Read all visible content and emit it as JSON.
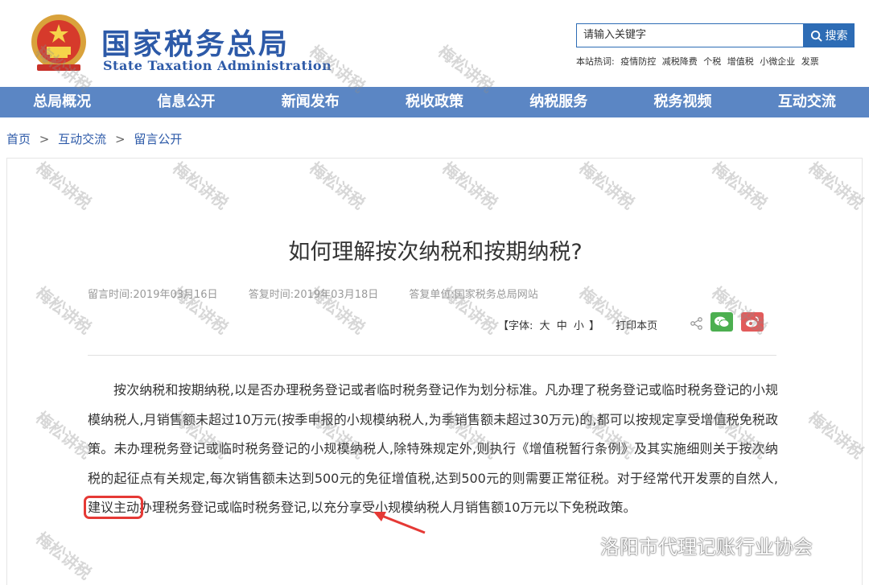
{
  "header": {
    "site_title": "国家税务总局",
    "site_subtitle": "State Taxation Administration",
    "search_placeholder": "请输入关键字",
    "search_button": "搜索",
    "hotwords_label": "本站热词:",
    "hotwords": [
      "疫情防控",
      "减税降费",
      "个税",
      "增值税",
      "小微企业",
      "发票"
    ]
  },
  "nav": {
    "items": [
      "总局概况",
      "信息公开",
      "新闻发布",
      "税收政策",
      "纳税服务",
      "税务视频",
      "互动交流"
    ]
  },
  "breadcrumb": {
    "items": [
      "首页",
      "互动交流",
      "留言公开"
    ],
    "separator": ">"
  },
  "article": {
    "title": "如何理解按次纳税和按期纳税?",
    "meta": {
      "message_time": "留言时间:2019年03月16日",
      "reply_time": "答复时间:2019年03月18日",
      "reply_unit": "答复单位:国家税务总局网站"
    },
    "tools": {
      "font_label": "【字体:",
      "sizes": [
        "大",
        "中",
        "小"
      ],
      "font_close": "】",
      "print": "打印本页"
    },
    "body_part1": "按次纳税和按期纳税,以是否办理税务登记或者临时税务登记作为划分标准。凡办理了税务登记或临时税务登记的小规模纳税人,月销售额未超过10万元(按季申报的小规模纳税人,为季销售额未超过30万元)的,都可以按规定享受增值税免税政策。未办理税务登记或临时税务登记的小规模纳税人,除特殊规定外,则执行《增值税暂行条例》及其实施细则关于按次纳税的起征点有关规定,每次销售额未达到500元的免征增值税,达到500元的则需要正常征税。对于经常代开发票的自然人,",
    "body_highlight": "建议主动",
    "body_part2": "办理税务登记或临时税务登记,以充分享受小规模纳税人月销售额10万元以下免税政策。"
  },
  "watermark": {
    "text": "梅松讲税"
  },
  "credit": {
    "text": "洛阳市代理记账行业协会"
  },
  "colors": {
    "brand_blue": "#2d5aa8",
    "nav_blue": "#5b86c4",
    "highlight_red": "#e53935",
    "wechat_green": "#4caf50",
    "weibo_red": "#e25b5b"
  }
}
